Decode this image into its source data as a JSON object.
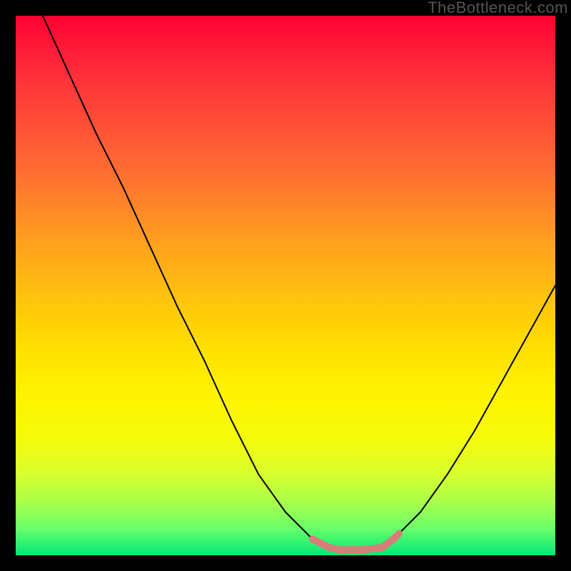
{
  "watermark": "TheBottleneck.com",
  "colors": {
    "curve": "#000000",
    "highlight": "#d97d78",
    "background_black": "#000000"
  },
  "chart_data": {
    "type": "line",
    "title": "",
    "xlabel": "",
    "ylabel": "",
    "xlim": [
      0,
      100
    ],
    "ylim": [
      0,
      100
    ],
    "series": [
      {
        "name": "bottleneck-curve",
        "x": [
          5,
          10,
          15,
          20,
          25,
          30,
          35,
          40,
          45,
          50,
          55,
          58,
          60,
          62,
          65,
          68,
          70,
          75,
          80,
          85,
          90,
          95,
          100
        ],
        "y": [
          100,
          89,
          78,
          68,
          57,
          46,
          36,
          25,
          15,
          8,
          3,
          1.5,
          1,
          1,
          1,
          1.5,
          3,
          8,
          15,
          23,
          32,
          41,
          50
        ]
      }
    ],
    "highlights": [
      {
        "name": "left-slope-highlight",
        "x": [
          55,
          57,
          58
        ],
        "y": [
          3,
          2,
          1.5
        ]
      },
      {
        "name": "valley-floor-highlight",
        "x": [
          58,
          60,
          62,
          64,
          66,
          68
        ],
        "y": [
          1.5,
          1,
          1,
          1,
          1.2,
          1.5
        ]
      },
      {
        "name": "right-slope-highlight",
        "x": [
          68,
          70,
          71
        ],
        "y": [
          1.5,
          3,
          4
        ]
      }
    ]
  }
}
